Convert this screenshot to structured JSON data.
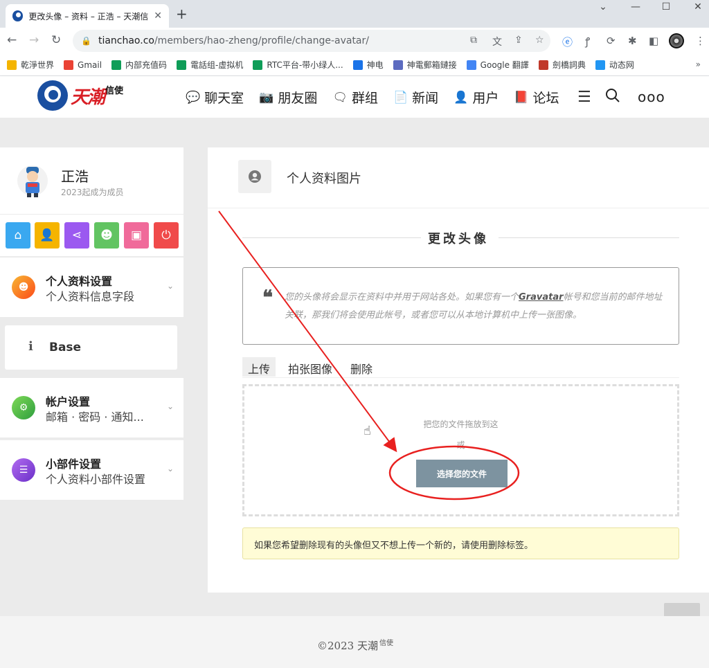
{
  "browser": {
    "tab_title": "更改头像 – 资料 – 正浩 – 天潮信",
    "url_host": "tianchao.co",
    "url_path": "/members/hao-zheng/profile/change-avatar/",
    "bookmarks": [
      {
        "label": "乾淨世界",
        "icon": "folder-icon",
        "color": "#f4b400"
      },
      {
        "label": "Gmail",
        "icon": "gmail-icon",
        "color": "#ea4335"
      },
      {
        "label": "内部充值码",
        "icon": "sheets-icon",
        "color": "#0f9d58"
      },
      {
        "label": "電話组-虚拟机",
        "icon": "sheets-icon",
        "color": "#0f9d58"
      },
      {
        "label": "RTC平台-带小绿人...",
        "icon": "sheets-icon",
        "color": "#0f9d58"
      },
      {
        "label": "神电",
        "icon": "power-icon",
        "color": "#1a73e8"
      },
      {
        "label": "神電郵箱鏈接",
        "icon": "globe-icon",
        "color": "#5c6bc0"
      },
      {
        "label": "Google 翻譯",
        "icon": "translate-icon",
        "color": "#4285f4"
      },
      {
        "label": "劍橋詞典",
        "icon": "shield-icon",
        "color": "#c0392b"
      },
      {
        "label": "动态网",
        "icon": "wave-icon",
        "color": "#2196f3"
      }
    ]
  },
  "site": {
    "logo_main": "天潮",
    "logo_sub": "信使",
    "nav": [
      {
        "label": "聊天室",
        "icon": "chat-icon",
        "glyph": "💬"
      },
      {
        "label": "朋友圈",
        "icon": "camera-icon",
        "glyph": "📷"
      },
      {
        "label": "群组",
        "icon": "group-chat-icon",
        "glyph": "🗨"
      },
      {
        "label": "新闻",
        "icon": "document-icon",
        "glyph": "📄"
      },
      {
        "label": "用户",
        "icon": "user-plus-icon",
        "glyph": "👤"
      },
      {
        "label": "论坛",
        "icon": "book-icon",
        "glyph": "📕"
      }
    ],
    "more": "ooo"
  },
  "sidebar": {
    "user_name": "正浩",
    "member_since": "2023起成为成员",
    "quick_buttons": [
      {
        "icon": "home-icon",
        "glyph": "⌂",
        "color": "#3aa8f0"
      },
      {
        "icon": "user-icon",
        "glyph": "👤",
        "color": "#f5b400"
      },
      {
        "icon": "share-icon",
        "glyph": "⋖",
        "color": "#9b59f0"
      },
      {
        "icon": "profile-icon",
        "glyph": "☻",
        "color": "#62c462"
      },
      {
        "icon": "media-icon",
        "glyph": "▣",
        "color": "#f06a9a"
      },
      {
        "icon": "power-icon",
        "glyph": "⏻",
        "color": "#f04a4a"
      }
    ],
    "menus": [
      {
        "title": "个人资料设置",
        "sub": "个人资料信息字段",
        "icon": "profile-settings-icon"
      },
      {
        "title": "帐户设置",
        "sub": "邮箱 · 密码 · 通知...",
        "icon": "gears-icon"
      },
      {
        "title": "小部件设置",
        "sub": "个人资料小部件设置",
        "icon": "sliders-icon"
      }
    ],
    "base_label": "Base",
    "base_icon_char": "i"
  },
  "main": {
    "header_title": "个人资料图片",
    "section_title": "更改头像",
    "quote_part1": "您的头像将会显示在资料中并用于网站各处。如果您有一个",
    "quote_link": "Gravatar",
    "quote_part2": "帐号和您当前的邮件地址关联，那我们将会使用此帐号，或者您可以从本地计算机中上传一张图像。",
    "tabs": [
      "上传",
      "拍张图像",
      "删除"
    ],
    "drop_text": "把您的文件拖放到这",
    "or_text": "或",
    "choose_button": "选择您的文件",
    "notice": "如果您希望删除现有的头像但又不想上传一个新的，请使用删除标签。"
  },
  "footer": {
    "text": "©2023 天潮",
    "sup": "信使"
  },
  "colors": {
    "annotation_red": "#e8201f",
    "button_slate": "#7d93a0"
  }
}
